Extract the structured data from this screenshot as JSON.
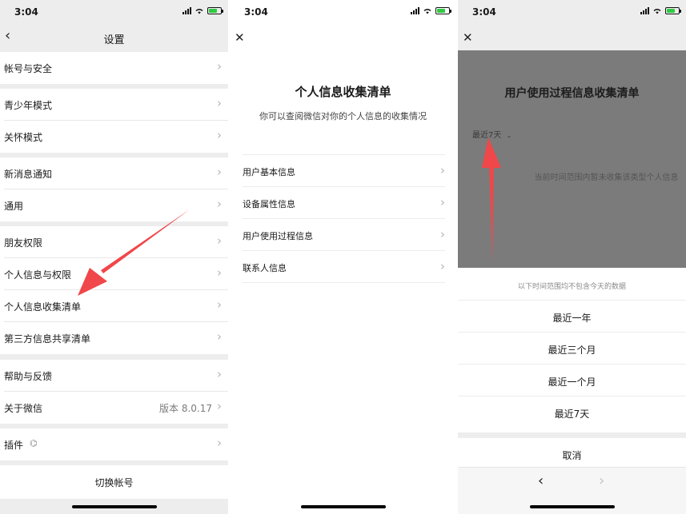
{
  "status_time": "3:04",
  "screen1": {
    "title": "设置",
    "rows": [
      {
        "label": "帐号与安全"
      },
      {
        "label": "青少年模式"
      },
      {
        "label": "关怀模式"
      },
      {
        "label": "新消息通知"
      },
      {
        "label": "通用"
      },
      {
        "label": "朋友权限"
      },
      {
        "label": "个人信息与权限"
      },
      {
        "label": "个人信息收集清单"
      },
      {
        "label": "第三方信息共享清单"
      },
      {
        "label": "帮助与反馈"
      },
      {
        "label": "关于微信",
        "value": "版本 8.0.17"
      },
      {
        "label": "插件"
      }
    ],
    "switch_account": "切换帐号"
  },
  "screen2": {
    "title": "个人信息收集清单",
    "subtitle": "你可以查阅微信对你的个人信息的收集情况",
    "rows": [
      {
        "label": "用户基本信息"
      },
      {
        "label": "设备属性信息"
      },
      {
        "label": "用户使用过程信息"
      },
      {
        "label": "联系人信息"
      }
    ]
  },
  "screen3": {
    "title": "用户使用过程信息收集清单",
    "range_label": "最近7天",
    "empty_text": "当前时间范围内暂未收集该类型个人信息",
    "sheet_note": "以下时间范围均不包含今天的数据",
    "options": [
      "最近一年",
      "最近三个月",
      "最近一个月",
      "最近7天"
    ],
    "cancel": "取消"
  },
  "colors": {
    "arrow": "#f0474a",
    "battery": "#2ecc40",
    "overlay": "#7b7b7b"
  }
}
